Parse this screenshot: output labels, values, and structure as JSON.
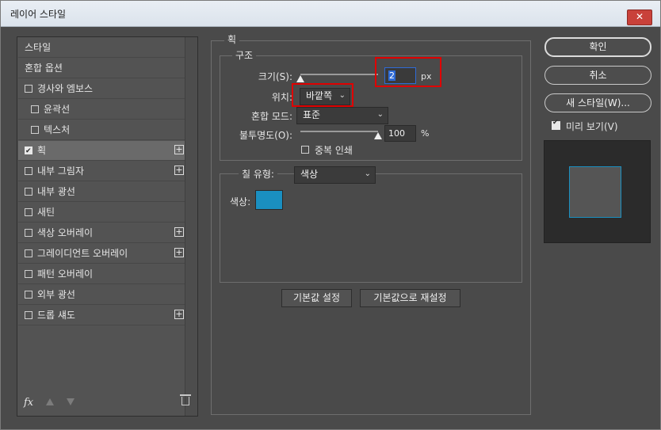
{
  "window": {
    "title": "레이어 스타일",
    "close_label": "✕"
  },
  "sidebar": {
    "items": [
      {
        "label": "스타일",
        "has_checkbox": false,
        "checked": false,
        "has_plus": false,
        "selected": false,
        "indent": 0
      },
      {
        "label": "혼합 옵션",
        "has_checkbox": false,
        "checked": false,
        "has_plus": false,
        "selected": false,
        "indent": 0
      },
      {
        "label": "경사와 엠보스",
        "has_checkbox": true,
        "checked": false,
        "has_plus": false,
        "selected": false,
        "indent": 0
      },
      {
        "label": "윤곽선",
        "has_checkbox": true,
        "checked": false,
        "has_plus": false,
        "selected": false,
        "indent": 1
      },
      {
        "label": "텍스처",
        "has_checkbox": true,
        "checked": false,
        "has_plus": false,
        "selected": false,
        "indent": 1
      },
      {
        "label": "획",
        "has_checkbox": true,
        "checked": true,
        "has_plus": true,
        "selected": true,
        "indent": 0
      },
      {
        "label": "내부 그림자",
        "has_checkbox": true,
        "checked": false,
        "has_plus": true,
        "selected": false,
        "indent": 0
      },
      {
        "label": "내부 광선",
        "has_checkbox": true,
        "checked": false,
        "has_plus": false,
        "selected": false,
        "indent": 0
      },
      {
        "label": "새틴",
        "has_checkbox": true,
        "checked": false,
        "has_plus": false,
        "selected": false,
        "indent": 0
      },
      {
        "label": "색상 오버레이",
        "has_checkbox": true,
        "checked": false,
        "has_plus": true,
        "selected": false,
        "indent": 0
      },
      {
        "label": "그레이디언트 오버레이",
        "has_checkbox": true,
        "checked": false,
        "has_plus": true,
        "selected": false,
        "indent": 0
      },
      {
        "label": "패턴 오버레이",
        "has_checkbox": true,
        "checked": false,
        "has_plus": false,
        "selected": false,
        "indent": 0
      },
      {
        "label": "외부 광선",
        "has_checkbox": true,
        "checked": false,
        "has_plus": false,
        "selected": false,
        "indent": 0
      },
      {
        "label": "드롭 섀도",
        "has_checkbox": true,
        "checked": false,
        "has_plus": true,
        "selected": false,
        "indent": 0
      }
    ],
    "footer": {
      "fx_label": "fx"
    }
  },
  "stroke": {
    "section_title": "획",
    "structure": {
      "title": "구조",
      "size_label": "크기(S):",
      "size_value": "2",
      "size_unit": "px",
      "size_slider": 0.0,
      "position_label": "위치:",
      "position_value": "바깥쪽",
      "blend_label": "혼합 모드:",
      "blend_value": "표준",
      "opacity_label": "불투명도(O):",
      "opacity_value": "100",
      "opacity_unit": "%",
      "opacity_slider": 1.0,
      "overprint_label": "중복 인쇄",
      "overprint_checked": false
    },
    "fill": {
      "type_label": "칠 유형:",
      "type_value": "색상",
      "color_label": "색상:",
      "color": "#1a8fc0"
    },
    "buttons": {
      "make_default": "기본값 설정",
      "reset_default": "기본값으로 재설정"
    }
  },
  "actions": {
    "ok": "확인",
    "cancel": "취소",
    "new_style": "새 스타일(W)...",
    "preview_label": "미리 보기(V)",
    "preview_checked": true
  },
  "colors": {
    "panel_bg": "#4a4a4a",
    "highlight": "#e00000",
    "accent_focus": "#2f6bd6"
  }
}
